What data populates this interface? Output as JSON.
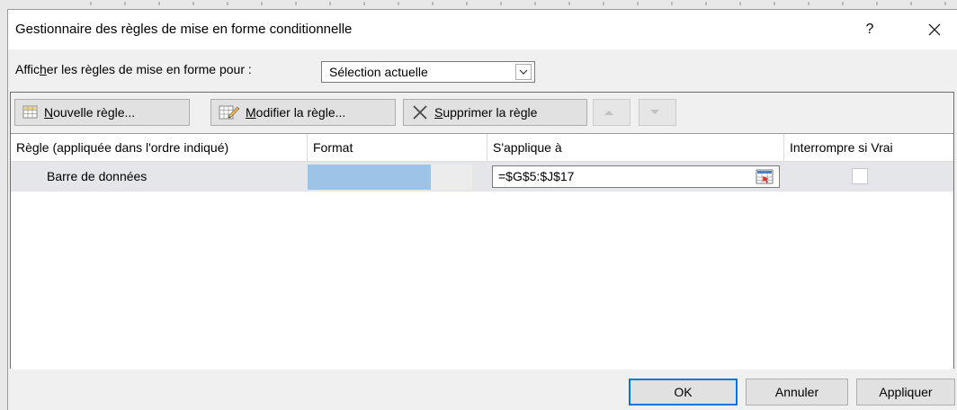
{
  "dialog": {
    "title": "Gestionnaire des règles de mise en forme conditionnelle",
    "help_label": "?"
  },
  "show_rules": {
    "label_pre": "Affic",
    "label_accel": "h",
    "label_post": "er les règles de mise en forme pour :",
    "selected": "Sélection actuelle"
  },
  "toolbar": {
    "new_rule_accel": "N",
    "new_rule_rest": "ouvelle règle...",
    "edit_rule_accel": "M",
    "edit_rule_rest": "odifier la règle...",
    "delete_rule_accel": "S",
    "delete_rule_rest": "upprimer la règle"
  },
  "grid": {
    "columns": [
      "Règle (appliquée dans l'ordre indiqué)",
      "Format",
      "S'applique à",
      "Interrompre si Vrai"
    ],
    "rows": [
      {
        "rule": "Barre de données",
        "format_fill": 0.75,
        "bar_color": "#9dc3e6",
        "applies_to": "=$G$5:$J$17",
        "stop_if_true": false
      }
    ]
  },
  "footer": {
    "ok": "OK",
    "cancel": "Annuler",
    "apply": "Appliquer"
  },
  "colors": {
    "accent": "#0078d7",
    "selected_row": "#e5e6ea"
  }
}
